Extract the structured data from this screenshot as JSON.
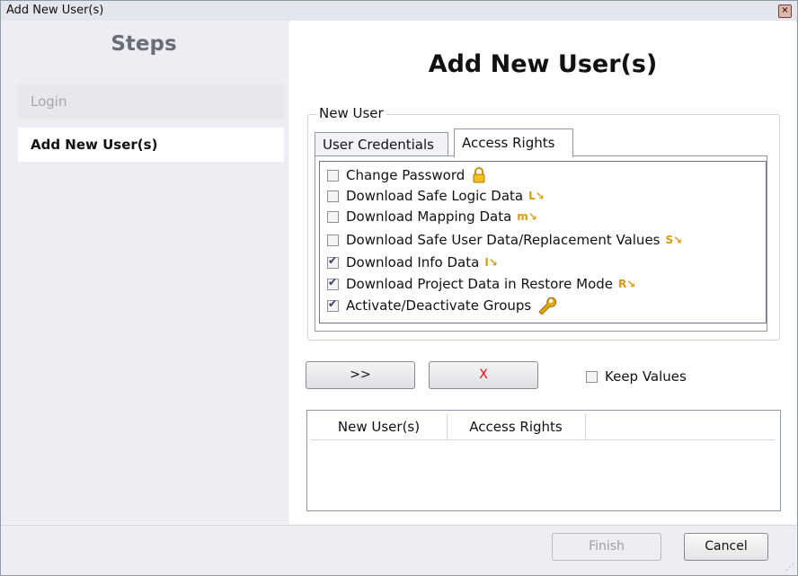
{
  "window": {
    "title": "Add New User(s)",
    "close_glyph": "×"
  },
  "steps": {
    "heading": "Steps",
    "items": [
      {
        "label": "Login",
        "state": "done"
      },
      {
        "label": "Add New User(s)",
        "state": "active"
      }
    ]
  },
  "main": {
    "title": "Add New User(s)",
    "group_label": "New User",
    "tabs": [
      {
        "label": "User Credentials",
        "selected": false
      },
      {
        "label": "Access Rights",
        "selected": true
      }
    ],
    "rights": [
      {
        "label": "Change Password",
        "checked": false,
        "icon": "lock-icon"
      },
      {
        "label": "Download Safe Logic Data",
        "checked": false,
        "icon": "logic-download-icon"
      },
      {
        "label": "Download Mapping Data",
        "checked": false,
        "icon": "mapping-download-icon"
      },
      {
        "label": "Download Safe User Data/Replacement Values",
        "checked": false,
        "icon": "user-data-download-icon"
      },
      {
        "label": "Download Info Data",
        "checked": true,
        "icon": "info-download-icon"
      },
      {
        "label": "Download Project Data in Restore Mode",
        "checked": true,
        "icon": "restore-download-icon"
      },
      {
        "label": "Activate/Deactivate Groups",
        "checked": true,
        "icon": "wrench-icon"
      }
    ],
    "add_button": ">>",
    "clear_button": "X",
    "keep_values": {
      "label": "Keep Values",
      "checked": false
    },
    "table": {
      "columns": [
        "New User(s)",
        "Access Rights"
      ],
      "rows": []
    }
  },
  "footer": {
    "finish": "Finish",
    "cancel": "Cancel",
    "finish_enabled": false
  },
  "colors": {
    "accent_icon": "#d89a10",
    "clear_red": "#dd1111"
  }
}
